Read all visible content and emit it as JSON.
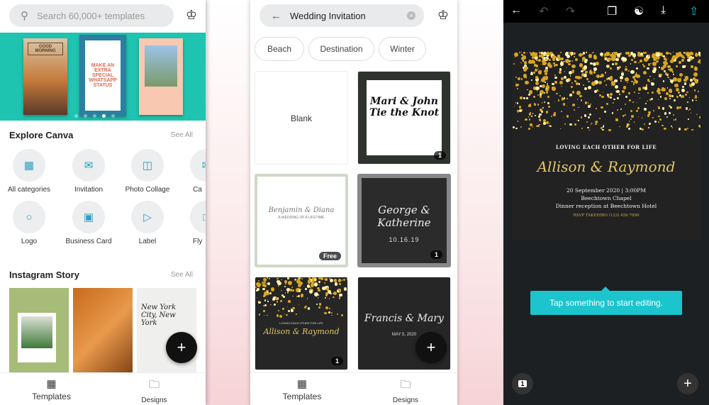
{
  "templates_screen": {
    "search": {
      "placeholder": "Search 60,000+ templates",
      "icon": "search-icon"
    },
    "premium_icon": "crown-icon",
    "banner": {
      "cards": [
        "GOOD MORNING",
        "MAKE AN EXTRA SPECIAL WHATSAPP STATUS",
        ""
      ],
      "page_count": 5,
      "active_page": 3,
      "accent": "#1fc4b0"
    },
    "explore": {
      "title": "Explore Canva",
      "see_all": "See All",
      "items": [
        {
          "label": "All categories",
          "icon": "grid-icon"
        },
        {
          "label": "Invitation",
          "icon": "envelope-icon"
        },
        {
          "label": "Photo Collage",
          "icon": "collage-icon"
        },
        {
          "label": "Ca",
          "icon": "card-icon"
        },
        {
          "label": "Logo",
          "icon": "logo-icon"
        },
        {
          "label": "Business Card",
          "icon": "business-card-icon"
        },
        {
          "label": "Label",
          "icon": "label-icon"
        },
        {
          "label": "Fly",
          "icon": "flyer-icon"
        }
      ]
    },
    "instagram": {
      "title": "Instagram Story",
      "see_all": "See All",
      "cards": [
        "",
        "",
        "New York City, New York"
      ]
    },
    "fab": "+",
    "tabs": [
      {
        "label": "Templates",
        "icon": "templates-icon"
      },
      {
        "label": "Designs",
        "icon": "folder-icon"
      }
    ]
  },
  "search_screen": {
    "query": "Wedding Invitation",
    "chips": [
      "Beach",
      "Destination",
      "Winter"
    ],
    "results": [
      {
        "title": "Blank"
      },
      {
        "title": "Mari & John Tie the Knot",
        "badge": "1"
      },
      {
        "title": "Benjamin & Diana",
        "subtitle": "A WEDDING OF A LIFETIME",
        "badge": "Free"
      },
      {
        "title": "George & Katherine",
        "subtitle": "10.16.19",
        "badge": "1"
      },
      {
        "title": "Allison & Raymond",
        "subtitle": "LOVING EACH OTHER FOR LIFE",
        "badge": "1"
      },
      {
        "title": "Francis & Mary",
        "subtitle": "MAY 5, 2020"
      }
    ],
    "fab": "+",
    "tabs": [
      {
        "label": "Templates",
        "icon": "templates-icon"
      },
      {
        "label": "Designs",
        "icon": "folder-icon"
      }
    ]
  },
  "editor_screen": {
    "toolbar": [
      "back-icon",
      "undo-icon",
      "redo-icon",
      "pages-icon",
      "share-people-icon",
      "download-icon",
      "upload-icon"
    ],
    "invitation": {
      "tagline": "LOVING EACH OTHER FOR LIFE",
      "names": "Allison & Raymond",
      "date": "20 September 2020 | 3:00PM",
      "venue": "Beechtown Chapel",
      "reception": "Dinner reception at Beechtown Hotel",
      "rsvp": "RSVP TAKEHIRO (123) 456 7890"
    },
    "tooltip": "Tap something to start editing.",
    "page_number": "1",
    "add": "+",
    "accent": "#1cc4cd"
  }
}
